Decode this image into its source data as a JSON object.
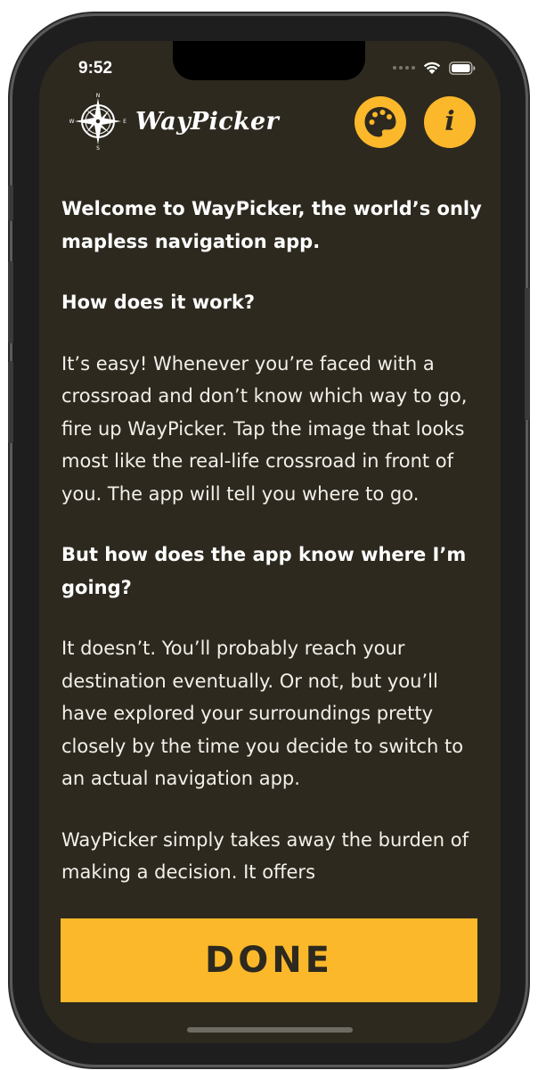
{
  "status_bar": {
    "time": "9:52",
    "icons": [
      "cellular-dots-icon",
      "wifi-icon",
      "battery-icon"
    ]
  },
  "header": {
    "app_name": "WayPicker",
    "logo_icon": "compass-rose-icon",
    "compass_letters": {
      "n": "N",
      "s": "S",
      "e": "E",
      "w": "W"
    },
    "theme_button_icon": "palette-icon",
    "info_button_glyph": "i"
  },
  "content": {
    "paragraphs": [
      {
        "style": "bold",
        "text": "Welcome to WayPicker, the world’s only mapless navigation app."
      },
      {
        "style": "bold",
        "text": "How does it work?"
      },
      {
        "style": "light",
        "text": "It’s easy! Whenever you’re faced with a crossroad and don’t know which way to go, fire up WayPicker. Tap the image that looks most like the real-life crossroad in front of you. The app will tell you where to go."
      },
      {
        "style": "bold",
        "text": "But how does the app know where I’m going?"
      },
      {
        "style": "light",
        "text": "It doesn’t. You’ll probably reach your destination eventually. Or not, but you’ll have explored your surroundings pretty closely by the time you decide to switch to an actual navigation app."
      },
      {
        "style": "light",
        "text": "WayPicker simply takes away the burden of making a decision. It offers"
      }
    ]
  },
  "footer": {
    "done_label": "DONE"
  },
  "colors": {
    "background": "#2d291f",
    "accent": "#fbb82a",
    "text": "#ffffff"
  }
}
